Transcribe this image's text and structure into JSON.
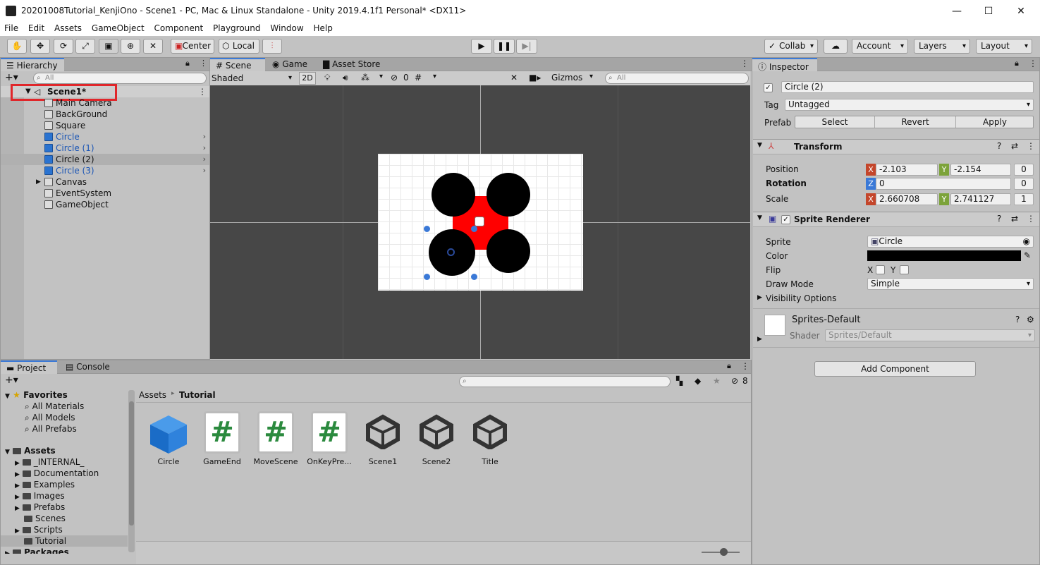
{
  "window": {
    "title": "20201008Tutorial_KenjiOno - Scene1 - PC, Mac & Linux Standalone - Unity 2019.4.1f1 Personal* <DX11>",
    "minimize": "—",
    "maximize": "☐",
    "close": "✕"
  },
  "menu": [
    "File",
    "Edit",
    "Assets",
    "GameObject",
    "Component",
    "Playground",
    "Window",
    "Help"
  ],
  "toolbar": {
    "center": "Center",
    "local": "Local",
    "collab": "Collab",
    "account": "Account",
    "layers": "Layers",
    "layout": "Layout"
  },
  "hierarchy": {
    "tab": "Hierarchy",
    "search_placeholder": "All",
    "scene": "Scene1*",
    "items": [
      {
        "label": "Main Camera",
        "prefab": false,
        "expandable": false
      },
      {
        "label": "BackGround",
        "prefab": false,
        "expandable": false
      },
      {
        "label": "Square",
        "prefab": false,
        "expandable": false
      },
      {
        "label": "Circle",
        "prefab": true,
        "expandable": true
      },
      {
        "label": "Circle (1)",
        "prefab": true,
        "expandable": true
      },
      {
        "label": "Circle (2)",
        "prefab": true,
        "expandable": true,
        "selected": true
      },
      {
        "label": "Circle (3)",
        "prefab": true,
        "expandable": true
      },
      {
        "label": "Canvas",
        "prefab": false,
        "expandable": false
      },
      {
        "label": "EventSystem",
        "prefab": false,
        "expandable": false
      },
      {
        "label": "GameObject",
        "prefab": false,
        "expandable": false
      }
    ]
  },
  "scene_tabs": {
    "scene": "Scene",
    "game": "Game",
    "asset_store": "Asset Store"
  },
  "scene_toolbar": {
    "shading": "Shaded",
    "mode_2d": "2D",
    "hidden_count": "0",
    "gizmos": "Gizmos",
    "search_placeholder": "All"
  },
  "inspector": {
    "tab": "Inspector",
    "object_name": "Circle (2)",
    "tag_label": "Tag",
    "tag_value": "Untagged",
    "prefab_label": "Prefab",
    "prefab_buttons": [
      "Select",
      "Revert",
      "Apply"
    ],
    "transform": {
      "title": "Transform",
      "position_label": "Position",
      "position": {
        "x": "-2.103",
        "y": "-2.154",
        "z": "0"
      },
      "rotation_label": "Rotation",
      "rotation": {
        "z": "0",
        "extra": "0"
      },
      "scale_label": "Scale",
      "scale": {
        "x": "2.660708",
        "y": "2.741127",
        "z": "1"
      }
    },
    "sprite_renderer": {
      "title": "Sprite Renderer",
      "sprite_label": "Sprite",
      "sprite_value": "Circle",
      "color_label": "Color",
      "color_value": "#000000",
      "flip_label": "Flip",
      "flip_x": "X",
      "flip_y": "Y",
      "draw_mode_label": "Draw Mode",
      "draw_mode_value": "Simple",
      "visibility_label": "Visibility Options"
    },
    "material": {
      "name": "Sprites-Default",
      "shader_label": "Shader",
      "shader_value": "Sprites/Default"
    },
    "add_component": "Add Component"
  },
  "project": {
    "tab_project": "Project",
    "tab_console": "Console",
    "hidden_count": "8",
    "breadcrumb_root": "Assets",
    "breadcrumb_sep": "▸",
    "breadcrumb_current": "Tutorial",
    "favorites_label": "Favorites",
    "favorites": [
      "All Materials",
      "All Models",
      "All Prefabs"
    ],
    "assets_label": "Assets",
    "folders": [
      {
        "label": "_INTERNAL_",
        "expandable": true
      },
      {
        "label": "Documentation",
        "expandable": true
      },
      {
        "label": "Examples",
        "expandable": true
      },
      {
        "label": "Images",
        "expandable": true
      },
      {
        "label": "Prefabs",
        "expandable": true
      },
      {
        "label": "Scenes",
        "expandable": false
      },
      {
        "label": "Scripts",
        "expandable": true
      },
      {
        "label": "Tutorial",
        "expandable": false,
        "selected": true
      }
    ],
    "packages_label": "Packages",
    "assets": [
      {
        "name": "Circle",
        "kind": "prefab"
      },
      {
        "name": "GameEnd",
        "kind": "script"
      },
      {
        "name": "MoveScene",
        "kind": "script"
      },
      {
        "name": "OnKeyPre...",
        "kind": "script"
      },
      {
        "name": "Scene1",
        "kind": "scene"
      },
      {
        "name": "Scene2",
        "kind": "scene"
      },
      {
        "name": "Title",
        "kind": "scene"
      }
    ],
    "script_glyph": "#"
  },
  "colors": {
    "accent": "#3a79d7",
    "highlight_box": "#e0262a",
    "red_square": "#ff0000",
    "prefab_blue": "#1a55b5"
  }
}
